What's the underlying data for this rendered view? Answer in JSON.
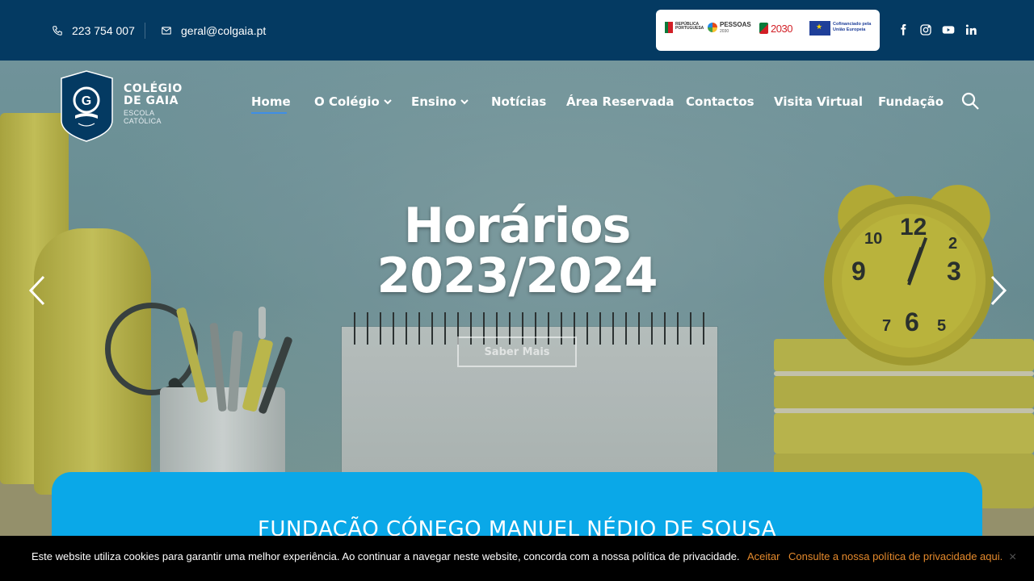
{
  "topbar": {
    "phone": "223 754 007",
    "email": "geral@colgaia.pt",
    "funding": {
      "label_1": "REPÚBLICA PORTUGUESA",
      "label_2": "PESSOAS",
      "label_2_sub": "2030",
      "label_3": "2030",
      "label_4": "Cofinanciado pela União Europeia"
    },
    "social": [
      "facebook-icon",
      "instagram-icon",
      "youtube-icon",
      "linkedin-icon"
    ]
  },
  "logo": {
    "name_line_1": "COLÉGIO",
    "name_line_2": "DE GAIA",
    "tagline": "ESCOLA CATÓLICA"
  },
  "nav": {
    "items": [
      {
        "label": "Home",
        "active": true,
        "dropdown": false
      },
      {
        "label": "O Colégio",
        "active": false,
        "dropdown": true
      },
      {
        "label": "Ensino",
        "active": false,
        "dropdown": true
      },
      {
        "label": "Notícias",
        "active": false,
        "dropdown": false
      },
      {
        "label": "Área Reservada",
        "active": false,
        "dropdown": false
      },
      {
        "label": "Contactos",
        "active": false,
        "dropdown": false
      },
      {
        "label": "Visita Virtual",
        "active": false,
        "dropdown": false
      },
      {
        "label": "Fundação",
        "active": false,
        "dropdown": false
      }
    ],
    "chevron": "⌄"
  },
  "slider": {
    "title_line_1": "Horários",
    "title_line_2": "2023/2024",
    "button": "Saber Mais"
  },
  "card": {
    "title": "FUNDAÇÃO CÓNEGO MANUEL NÉDIO DE SOUSA"
  },
  "cookie": {
    "text": "Este website utiliza cookies para garantir uma melhor experiência. Ao continuar a navegar neste website, concorda com a nossa política de privacidade.",
    "accept": "Aceitar",
    "policy": "Consulte a nossa política de privacidade aqui.",
    "close": "×"
  },
  "colors": {
    "topbar": "#043a62",
    "accent": "#0aa8e8",
    "cookie_link": "#e58a2c",
    "nav_active": "#3f8ee6"
  }
}
